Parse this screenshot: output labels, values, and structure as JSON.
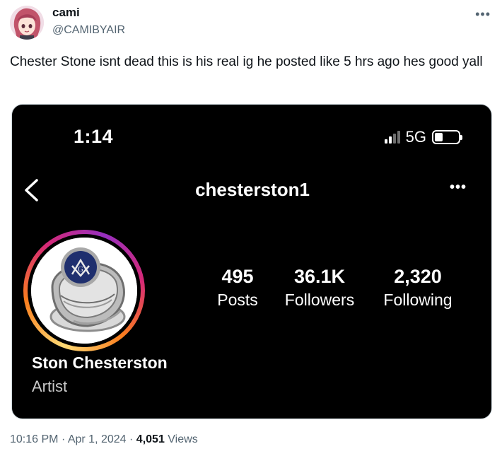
{
  "author": {
    "display_name": "cami",
    "handle": "@CAMIBYAIR"
  },
  "tweet": {
    "text": "Chester Stone isnt dead this is his real ig he posted like 5 hrs ago hes good yall"
  },
  "screenshot": {
    "status_bar": {
      "time": "1:14",
      "network": "5G",
      "signal_bars_lit": 2,
      "signal_bars_total": 4
    },
    "profile": {
      "username": "chesterston1",
      "display_name": "Ston Chesterston",
      "bio": "Artist",
      "stats": [
        {
          "value": "495",
          "label": "Posts"
        },
        {
          "value": "36.1K",
          "label": "Followers"
        },
        {
          "value": "2,320",
          "label": "Following"
        }
      ]
    }
  },
  "meta": {
    "time": "10:16 PM",
    "separator": "·",
    "date": "Apr 1, 2024",
    "views_count": "4,051",
    "views_label": "Views"
  },
  "icons": {
    "more": "more-horizontal-icon",
    "back": "chevron-left-icon"
  },
  "colors": {
    "text_primary": "#0f1419",
    "text_secondary": "#536471",
    "media_bg": "#000000"
  }
}
